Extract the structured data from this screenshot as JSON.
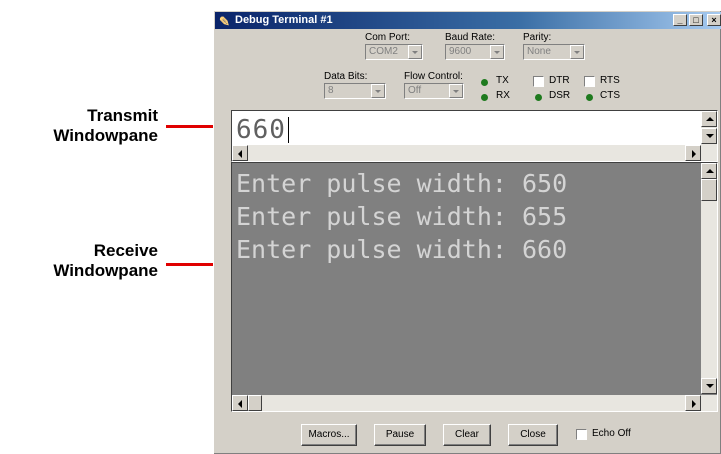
{
  "annotations": {
    "transmit_line1": "Transmit",
    "transmit_line2": "Windowpane",
    "receive_line1": "Receive",
    "receive_line2": "Windowpane",
    "arrow_color": "#e00000"
  },
  "window": {
    "title": "Debug Terminal #1",
    "title_icon": "wrench-icon",
    "controls": [
      "_",
      "□",
      "×"
    ]
  },
  "settings": {
    "com_port": {
      "label": "Com Port:",
      "value": "COM2"
    },
    "baud_rate": {
      "label": "Baud Rate:",
      "value": "9600"
    },
    "parity": {
      "label": "Parity:",
      "value": "None"
    },
    "data_bits": {
      "label": "Data Bits:",
      "value": "8"
    },
    "flow_control": {
      "label": "Flow Control:",
      "value": "Off"
    }
  },
  "indicators": {
    "tx": "TX",
    "rx": "RX",
    "dtr": "DTR",
    "rts": "RTS",
    "dsr": "DSR",
    "cts": "CTS",
    "led_color": "#1e7a1e"
  },
  "transmit": {
    "text": "660"
  },
  "receive": {
    "lines": [
      "Enter pulse width: 650",
      "Enter pulse width: 655",
      "Enter pulse width: 660"
    ]
  },
  "buttons": {
    "macros": "Macros...",
    "pause": "Pause",
    "clear": "Clear",
    "close": "Close",
    "echo_off": "Echo Off"
  }
}
